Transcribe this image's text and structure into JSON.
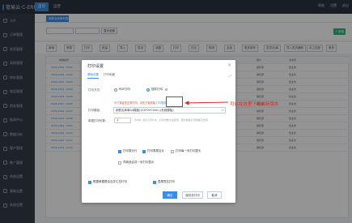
{
  "app": {
    "logo_text": "管易云·C-ERP",
    "nav_tabs": [
      "首页",
      "运营"
    ],
    "top_right": [
      "帮助",
      "设置",
      "退出"
    ]
  },
  "sidebar": {
    "items": [
      "卡片",
      "订单管理",
      "发货管理",
      "采购管理",
      "库存管理",
      "商品管理",
      "财务管理",
      "报表中心",
      "数据分析",
      "客户管理",
      "推广管理",
      "系统设置",
      "基础设置",
      "系统设置"
    ]
  },
  "page_tab": "销售出库单列表",
  "filter": {
    "search_button": "显示全部",
    "add_button": "+ 新增"
  },
  "toolbar": {
    "buttons": [
      "新增",
      "审核",
      "打印",
      "批量",
      "导入",
      "导出",
      "设置",
      "打印",
      "日志",
      "物流",
      "全选",
      "更多操作",
      "发货/出库",
      "导入发货通知",
      "手工匹配",
      "更多"
    ]
  },
  "table": {
    "header": [
      "单据编号",
      "客户",
      "业务员"
    ],
    "rows": [
      {
        "no": "XSCK-2021...0001",
        "dept": "销售部",
        "person": "张业务"
      },
      {
        "no": "XSCK-2021...0002",
        "dept": "销售部",
        "person": "张业务"
      },
      {
        "no": "XSCK-2021...0003",
        "dept": "销售部",
        "person": "张业务"
      },
      {
        "no": "XSCK-2021...0004",
        "dept": "销售部",
        "person": "张业务"
      },
      {
        "no": "XSCK-2021...0005",
        "dept": "销售部",
        "person": "张业务"
      },
      {
        "no": "XSCK-2021...0006",
        "dept": "销售部",
        "person": "张业务"
      },
      {
        "no": "XSCK-2021...0007",
        "dept": "销售部",
        "person": "张业务"
      },
      {
        "no": "XSCK-2021...0008",
        "dept": "销售部",
        "person": "张业务"
      },
      {
        "no": "XSCK-2021...0009",
        "dept": "销售部",
        "person": "张业务"
      },
      {
        "no": "XSCK-2021...0010",
        "dept": "销售部",
        "person": "张业务"
      },
      {
        "no": "XSCK-2021...0011",
        "dept": "销售部",
        "person": "张业务"
      },
      {
        "no": "XSCK-2021...0012",
        "dept": "销售部",
        "person": "张业务"
      }
    ]
  },
  "dialog": {
    "title": "打印设置",
    "tabs": [
      "基础设置",
      "打印明细"
    ],
    "print_method_label": "打印方式:",
    "radio_pdf": "PDF打印",
    "radio_plugin": "插件打印",
    "warning": "为了保证您正常打印，请先下载安装",
    "plugin_link": "打印插件",
    "template_label": "打印模板:",
    "template_value": "销售出库单A4模板(210*297mm) (系统模板)",
    "repeat_label": "单据打印份数:",
    "repeat_value": "1",
    "repeat_hint": "为0时，默认打印1次，打印份数为设置值，部分模板打印模板不支持",
    "check_print_header": "打印表头行",
    "check_print_footer": "打印表尾合计",
    "check_page": "打印每一页打印表头",
    "check_merge": "同商品合并一页打印显示",
    "check_bottom_left": "根据单据是否合并汇总打印",
    "check_bottom_right": "表尾签名打印",
    "buttons": {
      "ok": "确定",
      "save": "保存并打印",
      "cancel": "取消"
    }
  },
  "annotation": {
    "text": "可以在这里下载最新版本"
  }
}
